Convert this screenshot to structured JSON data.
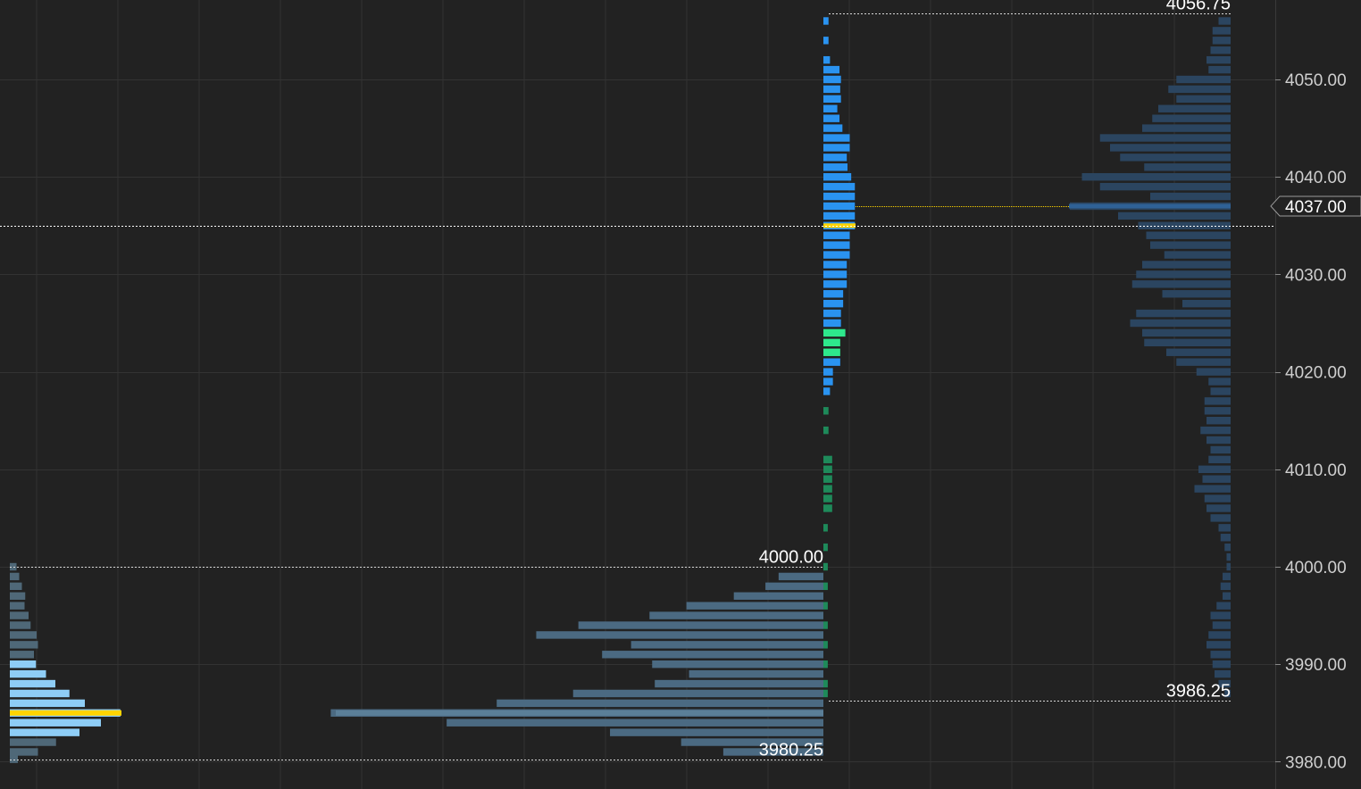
{
  "chart_data": {
    "type": "bar",
    "orientation": "horizontal",
    "y_axis": {
      "ylim": [
        3978,
        4058
      ],
      "ticks": [
        3980,
        3990,
        4000,
        4010,
        4020,
        4030,
        4040,
        4050
      ],
      "tick_labels": [
        "3980.00",
        "3990.00",
        "4000.00",
        "4010.00",
        "4020.00",
        "4030.00",
        "4040.00",
        "4050.00"
      ],
      "grid": true
    },
    "current_price": {
      "value": 4037.0,
      "label": "4037.00",
      "color": "#ffffff"
    },
    "crosshair_price": 4035,
    "profiles": [
      {
        "id": "session-1-mini",
        "price_low": 3980.25,
        "price_high": 4000.0,
        "high_label": "4000.00",
        "low_label": "3980.25",
        "poc": 3985.0,
        "value_area": [
          3982.5,
          3990.0
        ],
        "color_va": "#8ecdf6",
        "color_out": "#4f6878",
        "poc_color": "#ffd400",
        "levels": [
          {
            "price": 4000.0,
            "volume": 1
          },
          {
            "price": 3999.0,
            "volume": 1.4
          },
          {
            "price": 3998.0,
            "volume": 1.8
          },
          {
            "price": 3997.0,
            "volume": 2.3
          },
          {
            "price": 3996.0,
            "volume": 2.2
          },
          {
            "price": 3995.0,
            "volume": 2.8
          },
          {
            "price": 3994.0,
            "volume": 3.1
          },
          {
            "price": 3993.0,
            "volume": 4.0
          },
          {
            "price": 3992.0,
            "volume": 4.2
          },
          {
            "price": 3991.0,
            "volume": 3.6
          },
          {
            "price": 3990.0,
            "volume": 3.9
          },
          {
            "price": 3989.0,
            "volume": 5.4
          },
          {
            "price": 3988.0,
            "volume": 6.8
          },
          {
            "price": 3987.0,
            "volume": 8.9
          },
          {
            "price": 3986.0,
            "volume": 11.2
          },
          {
            "price": 3985.0,
            "volume": 16.5
          },
          {
            "price": 3984.0,
            "volume": 13.6
          },
          {
            "price": 3983.0,
            "volume": 10.4
          },
          {
            "price": 3982.0,
            "volume": 6.9
          },
          {
            "price": 3981.0,
            "volume": 4.2
          },
          {
            "price": 3980.25,
            "volume": 1.2
          }
        ]
      },
      {
        "id": "session-1-wide",
        "price_low": 3980.25,
        "price_high": 4000.0,
        "poc": 3985.0,
        "value_area": [
          3981.5,
          3993.0
        ],
        "color": "#4b6a82",
        "levels": [
          {
            "price": 3999.0,
            "volume": 1.7
          },
          {
            "price": 3998.0,
            "volume": 2.2
          },
          {
            "price": 3997.0,
            "volume": 3.4
          },
          {
            "price": 3996.0,
            "volume": 5.2
          },
          {
            "price": 3995.0,
            "volume": 6.6
          },
          {
            "price": 3994.0,
            "volume": 9.3
          },
          {
            "price": 3993.0,
            "volume": 10.9
          },
          {
            "price": 3992.0,
            "volume": 7.3
          },
          {
            "price": 3991.0,
            "volume": 8.4
          },
          {
            "price": 3990.0,
            "volume": 6.5
          },
          {
            "price": 3989.0,
            "volume": 5.1
          },
          {
            "price": 3988.0,
            "volume": 6.4
          },
          {
            "price": 3987.0,
            "volume": 9.5
          },
          {
            "price": 3986.0,
            "volume": 12.4
          },
          {
            "price": 3985.0,
            "volume": 18.7
          },
          {
            "price": 3984.0,
            "volume": 14.3
          },
          {
            "price": 3983.0,
            "volume": 8.1
          },
          {
            "price": 3982.0,
            "volume": 5.4
          },
          {
            "price": 3981.0,
            "volume": 3.8
          }
        ]
      },
      {
        "id": "session-2-mini",
        "price_low": 3986.25,
        "price_high": 4056.75,
        "poc": 4035.0,
        "color_upper": "#2a93f0",
        "color_lower": "#1e8a5a",
        "highlight_color": "#2ee88c",
        "poc_color": "#ffd400",
        "levels": [
          {
            "price": 4056.0,
            "volume": 0.7
          },
          {
            "price": 4054.0,
            "volume": 0.7
          },
          {
            "price": 4052.0,
            "volume": 0.9
          },
          {
            "price": 4051.0,
            "volume": 2.2
          },
          {
            "price": 4050.0,
            "volume": 2.4
          },
          {
            "price": 4049.0,
            "volume": 2.3
          },
          {
            "price": 4048.0,
            "volume": 2.4
          },
          {
            "price": 4047.0,
            "volume": 1.9
          },
          {
            "price": 4046.0,
            "volume": 2.2
          },
          {
            "price": 4045.0,
            "volume": 2.6
          },
          {
            "price": 4044.0,
            "volume": 3.6
          },
          {
            "price": 4043.0,
            "volume": 3.6
          },
          {
            "price": 4042.0,
            "volume": 3.2
          },
          {
            "price": 4041.0,
            "volume": 3.3
          },
          {
            "price": 4040.0,
            "volume": 3.8
          },
          {
            "price": 4039.0,
            "volume": 4.3
          },
          {
            "price": 4038.0,
            "volume": 4.3
          },
          {
            "price": 4037.0,
            "volume": 4.3
          },
          {
            "price": 4036.0,
            "volume": 4.3
          },
          {
            "price": 4035.0,
            "volume": 4.3
          },
          {
            "price": 4034.0,
            "volume": 3.6
          },
          {
            "price": 4033.0,
            "volume": 3.6
          },
          {
            "price": 4032.0,
            "volume": 3.6
          },
          {
            "price": 4031.0,
            "volume": 3.2
          },
          {
            "price": 4030.0,
            "volume": 3.2
          },
          {
            "price": 4029.0,
            "volume": 3.2
          },
          {
            "price": 4028.0,
            "volume": 2.7
          },
          {
            "price": 4027.0,
            "volume": 2.7
          },
          {
            "price": 4026.0,
            "volume": 2.4
          },
          {
            "price": 4025.0,
            "volume": 2.4
          },
          {
            "price": 4024.0,
            "volume": 3.0
          },
          {
            "price": 4023.0,
            "volume": 2.3
          },
          {
            "price": 4022.0,
            "volume": 2.3
          },
          {
            "price": 4021.0,
            "volume": 2.3
          },
          {
            "price": 4020.0,
            "volume": 1.3
          },
          {
            "price": 4019.0,
            "volume": 1.3
          },
          {
            "price": 4018.0,
            "volume": 0.9
          },
          {
            "price": 4016.0,
            "volume": 0.7
          },
          {
            "price": 4014.0,
            "volume": 0.7
          },
          {
            "price": 4011.0,
            "volume": 1.2
          },
          {
            "price": 4010.0,
            "volume": 1.2
          },
          {
            "price": 4009.0,
            "volume": 1.2
          },
          {
            "price": 4008.0,
            "volume": 1.2
          },
          {
            "price": 4007.0,
            "volume": 1.2
          },
          {
            "price": 4006.0,
            "volume": 1.2
          },
          {
            "price": 4004.0,
            "volume": 0.6
          },
          {
            "price": 4002.0,
            "volume": 0.6
          },
          {
            "price": 4000.0,
            "volume": 0.6
          },
          {
            "price": 3998.0,
            "volume": 0.6
          },
          {
            "price": 3996.0,
            "volume": 0.6
          },
          {
            "price": 3994.0,
            "volume": 0.6
          },
          {
            "price": 3992.0,
            "volume": 0.6
          },
          {
            "price": 3990.0,
            "volume": 0.6
          },
          {
            "price": 3988.0,
            "volume": 0.6
          },
          {
            "price": 3987.0,
            "volume": 0.6
          }
        ],
        "highlight_range": [
          4021.5,
          4024.5
        ]
      },
      {
        "id": "session-2-wide",
        "price_low": 3986.25,
        "price_high": 4056.75,
        "high_label": "4056.75",
        "low_label": "3986.25",
        "poc": 4037.0,
        "value_area": [
          4021.0,
          4049.0
        ],
        "color": "#2b4560",
        "poc_color": "#2f6196",
        "levels": [
          {
            "price": 4056.0,
            "volume": 0.6
          },
          {
            "price": 4055.0,
            "volume": 0.9
          },
          {
            "price": 4054.0,
            "volume": 0.9
          },
          {
            "price": 4053.0,
            "volume": 1.0
          },
          {
            "price": 4052.0,
            "volume": 1.2
          },
          {
            "price": 4051.0,
            "volume": 1.1
          },
          {
            "price": 4050.0,
            "volume": 2.7
          },
          {
            "price": 4049.0,
            "volume": 3.1
          },
          {
            "price": 4048.0,
            "volume": 2.7
          },
          {
            "price": 4047.0,
            "volume": 3.6
          },
          {
            "price": 4046.0,
            "volume": 3.9
          },
          {
            "price": 4045.0,
            "volume": 4.4
          },
          {
            "price": 4044.0,
            "volume": 6.5
          },
          {
            "price": 4043.0,
            "volume": 6.0
          },
          {
            "price": 4042.0,
            "volume": 5.5
          },
          {
            "price": 4041.0,
            "volume": 4.3
          },
          {
            "price": 4040.0,
            "volume": 7.4
          },
          {
            "price": 4039.0,
            "volume": 6.5
          },
          {
            "price": 4038.0,
            "volume": 4.0
          },
          {
            "price": 4037.0,
            "volume": 8.0
          },
          {
            "price": 4036.0,
            "volume": 5.6
          },
          {
            "price": 4035.0,
            "volume": 4.6
          },
          {
            "price": 4034.0,
            "volume": 4.2
          },
          {
            "price": 4033.0,
            "volume": 4.0
          },
          {
            "price": 4032.0,
            "volume": 3.3
          },
          {
            "price": 4031.0,
            "volume": 4.4
          },
          {
            "price": 4030.0,
            "volume": 4.7
          },
          {
            "price": 4029.0,
            "volume": 4.9
          },
          {
            "price": 4028.0,
            "volume": 3.4
          },
          {
            "price": 4027.0,
            "volume": 2.4
          },
          {
            "price": 4026.0,
            "volume": 4.7
          },
          {
            "price": 4025.0,
            "volume": 5.0
          },
          {
            "price": 4024.0,
            "volume": 4.4
          },
          {
            "price": 4023.0,
            "volume": 4.3
          },
          {
            "price": 4022.0,
            "volume": 3.2
          },
          {
            "price": 4021.0,
            "volume": 2.7
          },
          {
            "price": 4020.0,
            "volume": 1.7
          },
          {
            "price": 4019.0,
            "volume": 1.1
          },
          {
            "price": 4018.0,
            "volume": 1.0
          },
          {
            "price": 4017.0,
            "volume": 1.3
          },
          {
            "price": 4016.0,
            "volume": 1.3
          },
          {
            "price": 4015.0,
            "volume": 1.2
          },
          {
            "price": 4014.0,
            "volume": 1.5
          },
          {
            "price": 4013.0,
            "volume": 1.2
          },
          {
            "price": 4012.0,
            "volume": 1.0
          },
          {
            "price": 4011.0,
            "volume": 1.1
          },
          {
            "price": 4010.0,
            "volume": 1.6
          },
          {
            "price": 4009.0,
            "volume": 1.4
          },
          {
            "price": 4008.0,
            "volume": 1.8
          },
          {
            "price": 4007.0,
            "volume": 1.3
          },
          {
            "price": 4006.0,
            "volume": 1.2
          },
          {
            "price": 4005.0,
            "volume": 1.0
          },
          {
            "price": 4004.0,
            "volume": 0.6
          },
          {
            "price": 4003.0,
            "volume": 0.5
          },
          {
            "price": 4002.0,
            "volume": 0.3
          },
          {
            "price": 4001.0,
            "volume": 0.2
          },
          {
            "price": 4000.0,
            "volume": 0.2
          },
          {
            "price": 3999.0,
            "volume": 0.4
          },
          {
            "price": 3998.0,
            "volume": 0.5
          },
          {
            "price": 3997.0,
            "volume": 0.4
          },
          {
            "price": 3996.0,
            "volume": 0.7
          },
          {
            "price": 3995.0,
            "volume": 1.0
          },
          {
            "price": 3994.0,
            "volume": 0.9
          },
          {
            "price": 3993.0,
            "volume": 1.1
          },
          {
            "price": 3992.0,
            "volume": 1.2
          },
          {
            "price": 3991.0,
            "volume": 1.0
          },
          {
            "price": 3990.0,
            "volume": 0.9
          },
          {
            "price": 3989.0,
            "volume": 0.8
          },
          {
            "price": 3988.0,
            "volume": 0.6
          },
          {
            "price": 3987.0,
            "volume": 0.3
          }
        ]
      }
    ],
    "colors": {
      "background": "#222222",
      "grid": "#333333",
      "range_line": "#d8d8d8",
      "crosshair": "#ffffff",
      "poc_line": "#ffd400"
    }
  }
}
